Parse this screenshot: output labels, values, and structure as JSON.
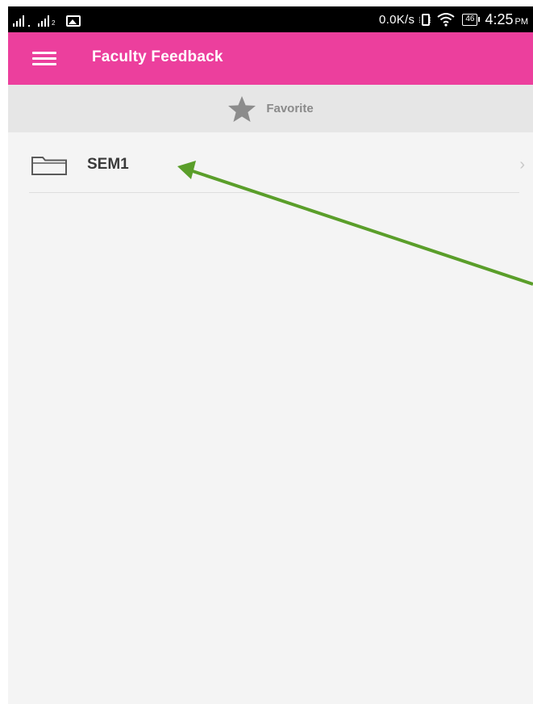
{
  "status_bar": {
    "network_speed": "0.0K/s",
    "battery_level": "46",
    "time": "4:25",
    "ampm": "PM",
    "sim2_index": "2"
  },
  "app_bar": {
    "title": "Faculty Feedback",
    "menu_icon": "hamburger-menu-icon",
    "background_color": "#ec3f9d"
  },
  "favorite_tab": {
    "label": "Favorite",
    "icon": "star-icon"
  },
  "list": {
    "items": [
      {
        "label": "SEM1",
        "icon": "folder-icon",
        "trailing_icon": "chevron-right-icon"
      }
    ]
  },
  "annotation": {
    "color": "#5a9e2a"
  }
}
